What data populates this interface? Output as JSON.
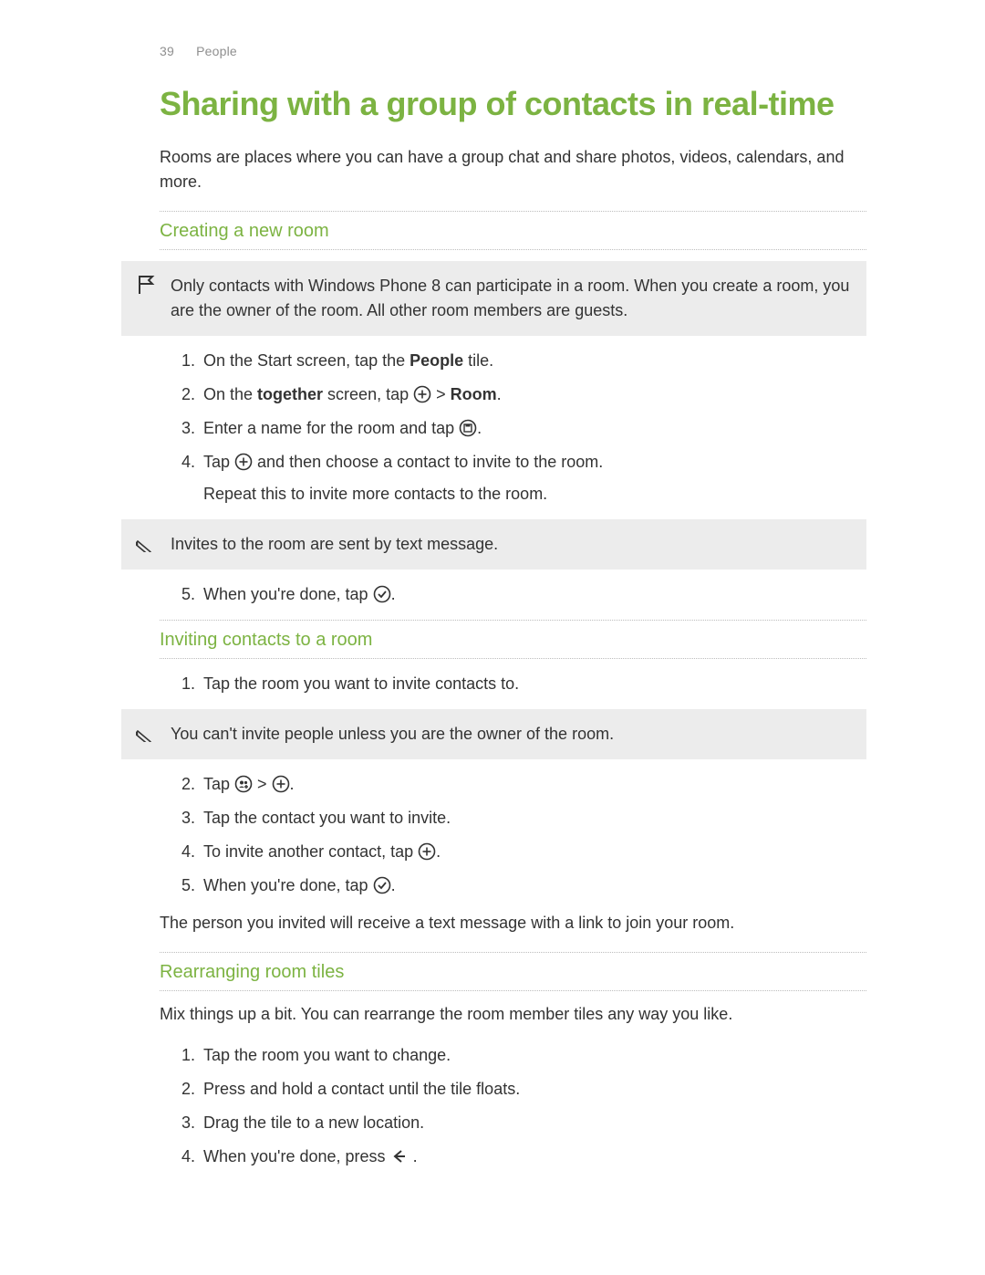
{
  "header": {
    "page_number": "39",
    "section": "People"
  },
  "title": "Sharing with a group of contacts in real-time",
  "intro": "Rooms are places where you can have a group chat and share photos, videos, calendars, and more.",
  "sections": {
    "creating": {
      "heading": "Creating a new room",
      "flag_note": "Only contacts with Windows Phone 8 can participate in a room. When you create a room, you are the owner of the room. All other room members are guests.",
      "steps_a": {
        "s1_a": "On the Start screen, tap the ",
        "s1_b": "People",
        "s1_c": " tile.",
        "s2_a": "On the ",
        "s2_b": "together",
        "s2_c": " screen, tap ",
        "s2_d": " > ",
        "s2_e": "Room",
        "s2_f": ".",
        "s3_a": "Enter a name for the room and tap ",
        "s3_b": ".",
        "s4_a": "Tap ",
        "s4_b": " and then choose a contact to invite to the room.",
        "s4_cont": "Repeat this to invite more contacts to the room."
      },
      "pencil_note": "Invites to the room are sent by text message.",
      "steps_b": {
        "s5_a": "When you're done, tap ",
        "s5_b": "."
      }
    },
    "inviting": {
      "heading": "Inviting contacts to a room",
      "steps_a": {
        "s1": "Tap the room you want to invite contacts to."
      },
      "pencil_note": "You can't invite people unless you are the owner of the room.",
      "steps_b": {
        "s2_a": "Tap ",
        "s2_b": " > ",
        "s2_c": ".",
        "s3": "Tap the contact you want to invite.",
        "s4_a": "To invite another contact, tap ",
        "s4_b": ".",
        "s5_a": "When you're done, tap ",
        "s5_b": "."
      },
      "outro": "The person you invited will receive a text message with a link to join your room."
    },
    "rearranging": {
      "heading": "Rearranging room tiles",
      "intro": "Mix things up a bit. You can rearrange the room member tiles any way you like.",
      "steps": {
        "s1": "Tap the room you want to change.",
        "s2": "Press and hold a contact until the tile floats.",
        "s3": "Drag the tile to a new location.",
        "s4_a": "When you're done, press ",
        "s4_b": " ."
      }
    }
  }
}
